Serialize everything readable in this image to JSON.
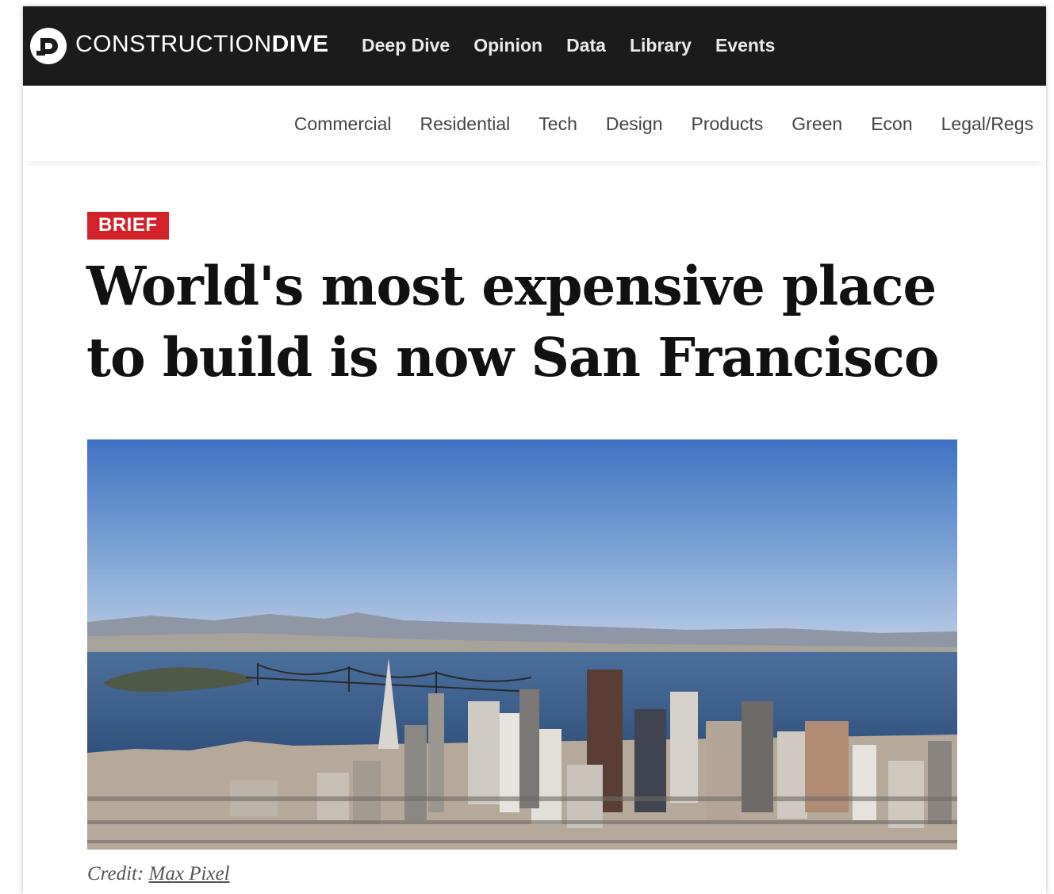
{
  "brand": {
    "name_light": "CONSTRUCTION",
    "name_bold": "DIVE",
    "colors": {
      "topbar": "#1b1b1b",
      "badge": "#d2232a",
      "text": "#111111"
    }
  },
  "main_nav": [
    "Deep Dive",
    "Opinion",
    "Data",
    "Library",
    "Events"
  ],
  "sub_nav": [
    "Commercial",
    "Residential",
    "Tech",
    "Design",
    "Products",
    "Green",
    "Econ",
    "Legal/Regs"
  ],
  "article": {
    "badge": "BRIEF",
    "headline_line1": "World's most expensive place",
    "headline_line2": "to build is now San Francisco",
    "image_subject": "aerial view of San Francisco skyline with Bay Bridge",
    "credit_label": "Credit:",
    "credit_name": "Max Pixel"
  }
}
